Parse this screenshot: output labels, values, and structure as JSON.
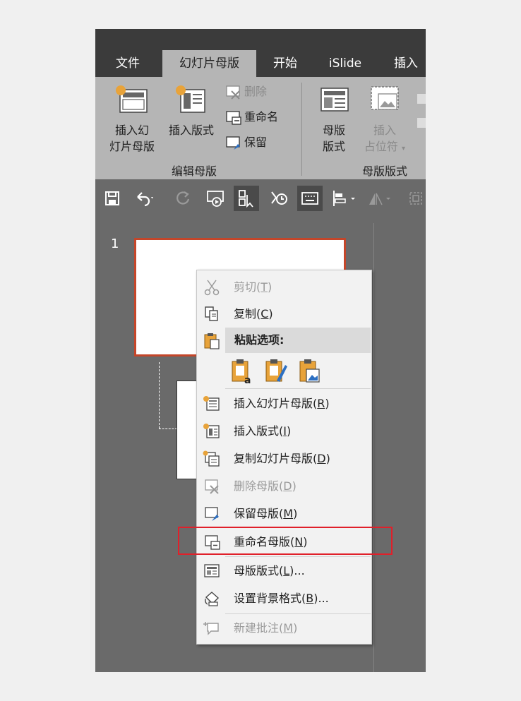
{
  "tabs": [
    "文件",
    "幻灯片母版",
    "开始",
    "iSlide",
    "插入"
  ],
  "active_tab": "幻灯片母版",
  "ribbon": {
    "edit_master_group": {
      "label": "编辑母版",
      "insert_slide_master_l1": "插入幻",
      "insert_slide_master_l2": "灯片母版",
      "insert_layout": "插入版式",
      "delete": "删除",
      "rename": "重命名",
      "preserve": "保留"
    },
    "master_layout_group": {
      "label": "母版版式",
      "master_layout_l1": "母版",
      "master_layout_l2": "版式",
      "insert_placeholder_l1": "插入",
      "insert_placeholder_l2": "占位符"
    }
  },
  "slide_panel": {
    "slide_number": "1"
  },
  "context_menu": {
    "cut": {
      "text": "剪切(",
      "key": "T",
      "end": ")"
    },
    "copy": {
      "text": "复制(",
      "key": "C",
      "end": ")"
    },
    "paste_options": "粘贴选项:",
    "insert_slide_master": {
      "text": "插入幻灯片母版(",
      "key": "R",
      "end": ")"
    },
    "insert_layout": {
      "text": "插入版式(",
      "key": "I",
      "end": ")"
    },
    "duplicate_slide_master": {
      "text": "复制幻灯片母版(",
      "key": "D",
      "end": ")"
    },
    "delete_master": {
      "text": "删除母版(",
      "key": "D",
      "end": ")"
    },
    "preserve_master": {
      "text": "保留母版(",
      "key": "M",
      "end": ")"
    },
    "rename_master": {
      "text": "重命名母版(",
      "key": "N",
      "end": ")"
    },
    "master_layout": {
      "text": "母版版式(",
      "key": "L",
      "end": ")..."
    },
    "format_background": {
      "text": "设置背景格式(",
      "key": "B",
      "end": ")..."
    },
    "new_comment": {
      "text": "新建批注(",
      "key": "M",
      "end": ")"
    }
  },
  "colors": {
    "highlight_border": "#e0202a",
    "selected_slide_border": "#c4462a",
    "accent_orange": "#e8a33a"
  },
  "icons": [
    "save-icon",
    "undo-icon",
    "redo-icon",
    "from-beginning-icon",
    "touch-select-icon",
    "rehearse-icon",
    "keyboard-icon",
    "align-icon",
    "rotate-icon",
    "group-icon",
    "scissors-icon",
    "copy-icon",
    "paste-icon",
    "keep-text-only-icon",
    "keep-source-format-icon",
    "paste-picture-icon",
    "insert-slide-master-icon",
    "insert-layout-icon",
    "duplicate-master-icon",
    "delete-master-icon",
    "preserve-master-icon",
    "rename-master-icon",
    "master-layout-icon",
    "format-background-icon",
    "new-comment-icon"
  ]
}
